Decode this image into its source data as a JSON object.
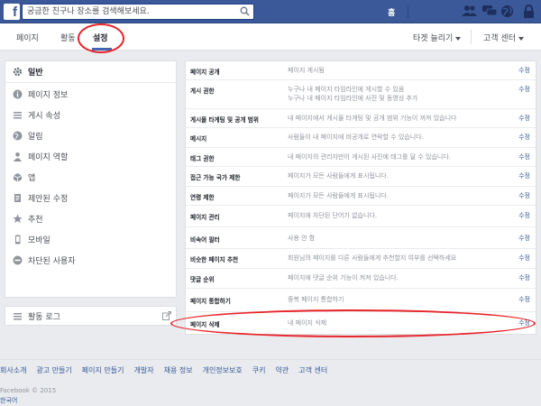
{
  "topbar": {
    "logo_letter": "f",
    "search_placeholder": "궁금한 친구나 장소를 검색해보세요.",
    "home_label": "홈",
    "icons": [
      "friends-icon",
      "messages-icon",
      "globe-icon",
      "lock-icon"
    ],
    "brand_color": "#3b5998"
  },
  "nav": {
    "tabs": [
      {
        "label": "페이지",
        "active": false
      },
      {
        "label": "활동",
        "active": false
      },
      {
        "label": "설정",
        "active": true
      }
    ],
    "targeting_label": "타겟 늘리기",
    "help_label": "고객 센터"
  },
  "sidebar": {
    "items": [
      {
        "label": "일반",
        "icon": "gear-icon",
        "active": true
      },
      {
        "label": "페이지 정보",
        "icon": "info-icon",
        "active": false
      },
      {
        "label": "게시 속성",
        "icon": "list-icon",
        "active": false
      },
      {
        "label": "알림",
        "icon": "globe-icon",
        "active": false
      },
      {
        "label": "페이지 역할",
        "icon": "person-icon",
        "active": false
      },
      {
        "label": "앱",
        "icon": "cube-icon",
        "active": false
      },
      {
        "label": "제안된 수정",
        "icon": "document-icon",
        "active": false
      },
      {
        "label": "추천",
        "icon": "star-icon",
        "active": false
      },
      {
        "label": "모바일",
        "icon": "mobile-icon",
        "active": false
      },
      {
        "label": "차단된 사용자",
        "icon": "blocked-icon",
        "active": false
      }
    ],
    "activity_log_label": "활동 로그"
  },
  "settings": {
    "edit_label": "수정",
    "rows": [
      {
        "label": "페이지 공개",
        "value": [
          "페이지 게시됨"
        ]
      },
      {
        "label": "게시 권한",
        "value": [
          "누구나 내 페이지 타임라인에 게시할 수 있음",
          "누구나 내 페이지 타임라인에 사진 및 동영상 추가"
        ]
      },
      {
        "label": "게시물 타게팅 및 공개 범위",
        "value": [
          "내 페이지에서 게시물 타게팅 및 공개 범위 기능이 꺼져 있습니다"
        ]
      },
      {
        "label": "메시지",
        "value": [
          "사람들이 내 페이지에 비공개로 연락할 수 있습니다."
        ]
      },
      {
        "label": "태그 권한",
        "value": [
          "내 페이지의 관리자만이 게시된 사진에 태그를 달 수 있습니다."
        ]
      },
      {
        "label": "접근 가능 국가 제한",
        "value": [
          "페이지가 모든 사람들에게 표시됩니다."
        ]
      },
      {
        "label": "연령 제한",
        "value": [
          "페이지가 모든 사람들에게 표시됩니다."
        ]
      },
      {
        "label": "페이지 관리",
        "value": [
          "페이지에 차단된 단어가 없습니다."
        ]
      },
      {
        "label": "비속어 필터",
        "value": [
          "사용 안 함"
        ]
      },
      {
        "label": "비슷한 페이지 추천",
        "value": [
          "회원님의 페이지를 다른 사람들에게 추천할지 여부를 선택하세요"
        ]
      },
      {
        "label": "댓글 순위",
        "value": [
          "페이지에 댓글 순위 기능이 켜져 있습니다."
        ]
      },
      {
        "label": "페이지 통합하기",
        "value": [
          "중복 페이지 통합하기"
        ]
      },
      {
        "label": "페이지 삭제",
        "value": [
          "내 페이지 삭제"
        ]
      }
    ]
  },
  "footer": {
    "links": [
      "회사소개",
      "광고 만들기",
      "페이지 만들기",
      "개발자",
      "채용 정보",
      "개인정보보호",
      "쿠키",
      "약관",
      "고객 센터"
    ],
    "copyright": "Facebook © 2015",
    "language": "한국어"
  },
  "annotation_color": "#e8252a"
}
